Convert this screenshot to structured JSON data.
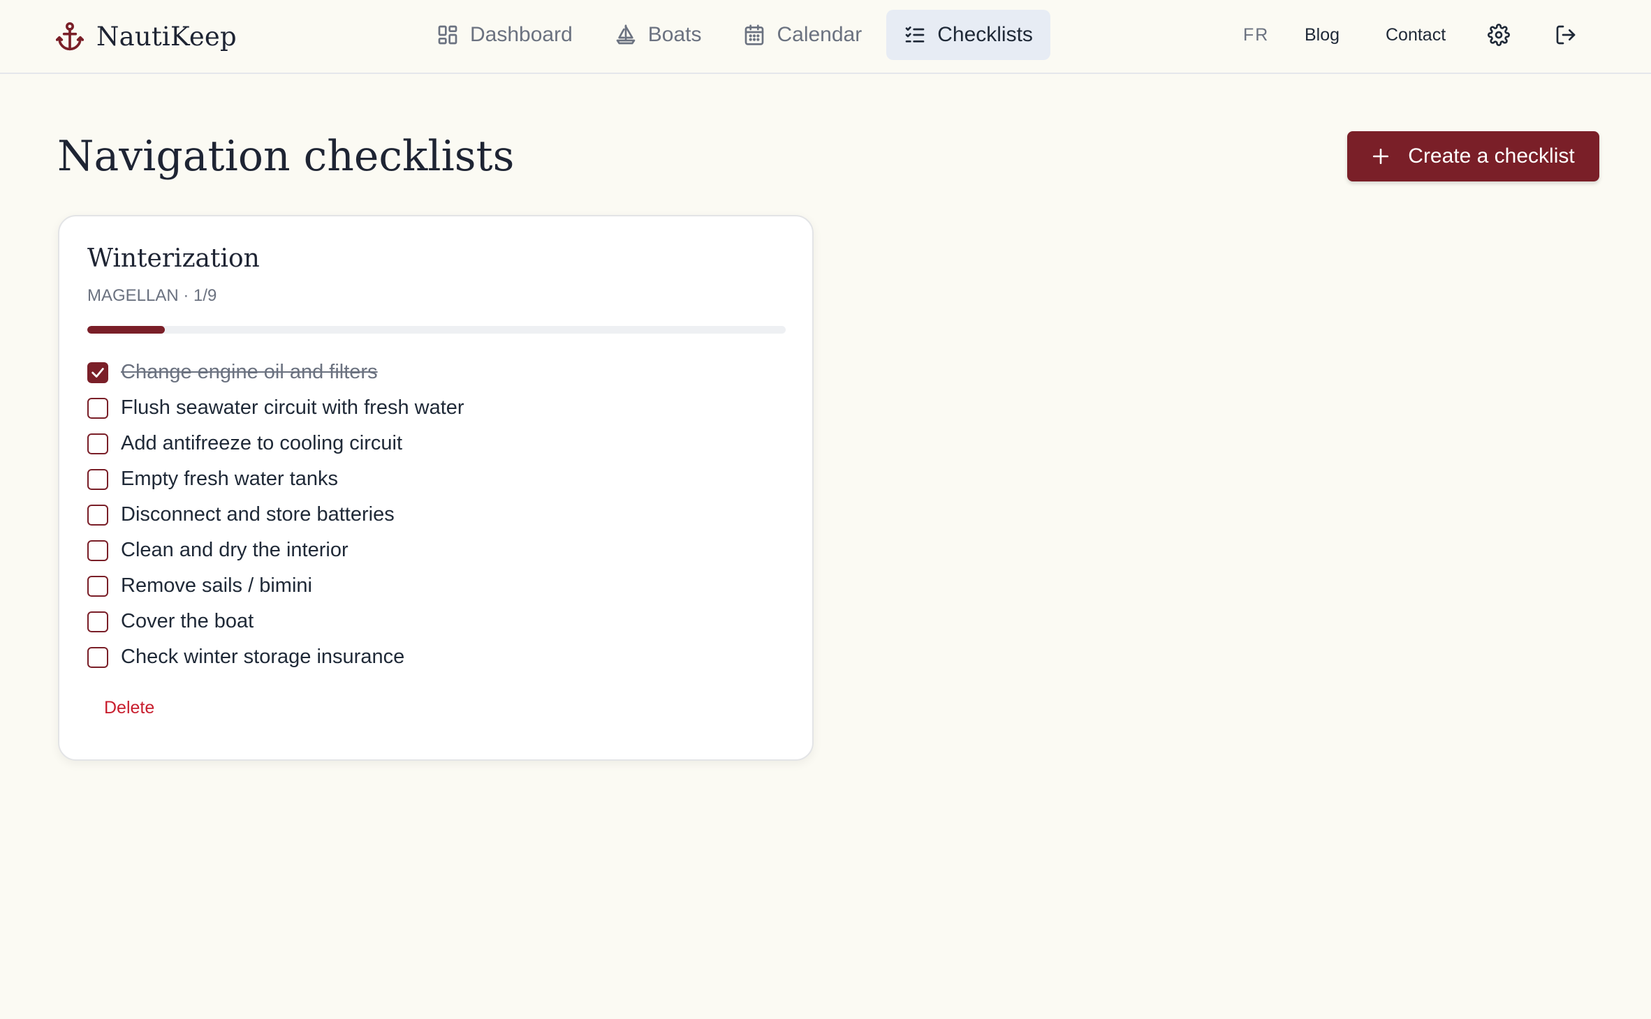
{
  "app": {
    "name": "NautiKeep"
  },
  "nav": {
    "items": [
      {
        "label": "Dashboard",
        "icon": "dashboard-icon",
        "active": false
      },
      {
        "label": "Boats",
        "icon": "sailboat-icon",
        "active": false
      },
      {
        "label": "Calendar",
        "icon": "calendar-icon",
        "active": false
      },
      {
        "label": "Checklists",
        "icon": "checklist-icon",
        "active": true
      }
    ],
    "lang": "FR",
    "blog": "Blog",
    "contact": "Contact",
    "settings_icon": "gear-icon",
    "logout_icon": "logout-icon"
  },
  "main": {
    "title": "Navigation checklists",
    "create_button": "Create a checklist"
  },
  "checklist": {
    "title": "Winterization",
    "meta": "MAGELLAN · 1/9",
    "progress_fraction": 0.111,
    "items": [
      {
        "label": "Change engine oil and filters",
        "checked": true
      },
      {
        "label": "Flush seawater circuit with fresh water",
        "checked": false
      },
      {
        "label": "Add antifreeze to cooling circuit",
        "checked": false
      },
      {
        "label": "Empty fresh water tanks",
        "checked": false
      },
      {
        "label": "Disconnect and store batteries",
        "checked": false
      },
      {
        "label": "Clean and dry the interior",
        "checked": false
      },
      {
        "label": "Remove sails / bimini",
        "checked": false
      },
      {
        "label": "Cover the boat",
        "checked": false
      },
      {
        "label": "Check winter storage insurance",
        "checked": false
      }
    ],
    "delete_label": "Delete"
  },
  "colors": {
    "accent": "#7a1f28",
    "background": "#fbfaf3",
    "danger": "#c81e2e"
  }
}
